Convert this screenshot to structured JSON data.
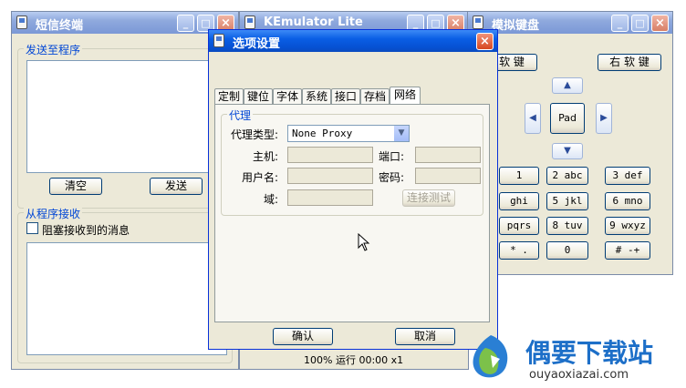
{
  "sms_window": {
    "title": "短信终端",
    "send_group": "发送至程序",
    "clear_btn": "清空",
    "send_btn": "发送",
    "recv_group": "从程序接收",
    "block_checkbox": "阻塞接收到的消息"
  },
  "emulator_window": {
    "title": "KEmulator Lite",
    "status": "100% 运行 00:00 x1"
  },
  "keyboard_window": {
    "title": "模拟键盘",
    "left_soft": "软 键",
    "right_soft": "右 软 键",
    "pad": "Pad",
    "up": "▲",
    "down": "▼",
    "left": "◀",
    "right": "▶",
    "keys": [
      "1",
      "2 abc",
      "3 def",
      "ghi",
      "5 jkl",
      "6 mno",
      "pqrs",
      "8 tuv",
      "9 wxyz",
      "* .",
      "0",
      "# -+"
    ]
  },
  "dialog": {
    "title": "选项设置",
    "tabs": [
      "定制",
      "键位",
      "字体",
      "系统",
      "接口",
      "存档",
      "网络"
    ],
    "proxy_group": "代理",
    "proxy_type_label": "代理类型:",
    "proxy_type_value": "None Proxy",
    "host_label": "主机:",
    "port_label": "端口:",
    "user_label": "用户名:",
    "password_label": "密码:",
    "domain_label": "域:",
    "test_button": "连接测试",
    "ok_button": "确认",
    "cancel_button": "取消"
  },
  "watermark": {
    "brand": "偶要下载站",
    "url": "ouyaoxiazai.com"
  },
  "colors": {
    "titlebar_active": "#0a5ee5",
    "window_face": "#ece9d8",
    "group_label": "#0046d5",
    "watermark_blue": "#1d6fc8"
  }
}
